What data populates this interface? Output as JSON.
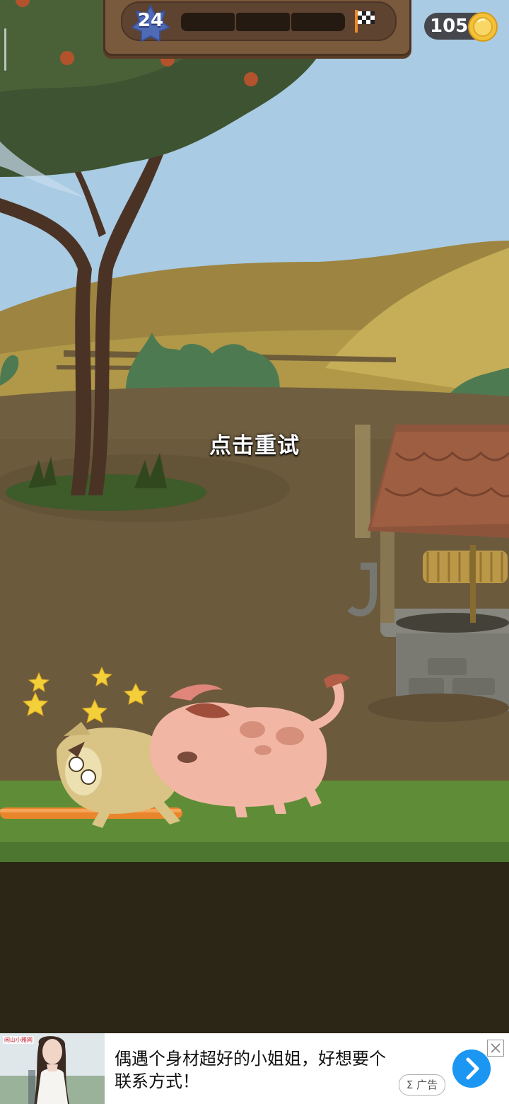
{
  "hud": {
    "level": "24",
    "progress": {
      "segments": 3,
      "filled": 0
    },
    "coins": "105"
  },
  "overlay": {
    "retry_text": "点击重试"
  },
  "ad": {
    "text": "偶遇个身材超好的小姐姐，好想要个联系方式！",
    "label": "Σ 广告",
    "source": "闲山小雅网"
  },
  "colors": {
    "sky": "#a9cbe3",
    "hills": "#a78c43",
    "ground": "#6e5a3c",
    "grass": "#5f8d37",
    "level_badge": "#4f6bb6",
    "coin": "#f2c23a",
    "ad_button": "#1b96f3"
  }
}
